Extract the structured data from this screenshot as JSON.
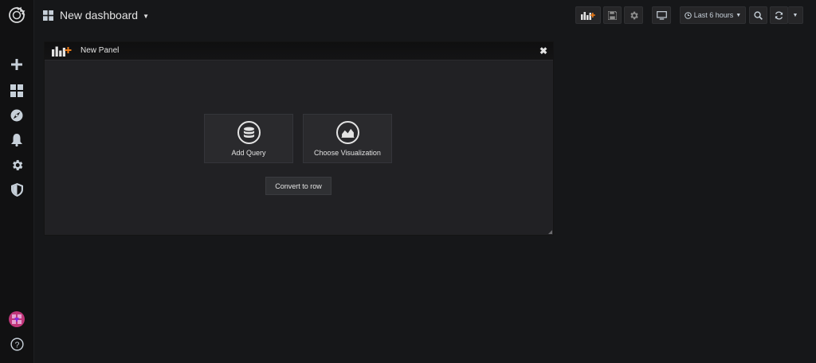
{
  "topbar": {
    "dashboard_title": "New dashboard",
    "time_range": "Last 6 hours"
  },
  "sidebar": {
    "items": [
      {
        "icon": "plus-icon"
      },
      {
        "icon": "dashboards-icon"
      },
      {
        "icon": "compass-icon"
      },
      {
        "icon": "bell-icon"
      },
      {
        "icon": "gear-icon"
      },
      {
        "icon": "shield-icon"
      }
    ],
    "bottom": [
      {
        "icon": "avatar"
      },
      {
        "icon": "help-icon"
      }
    ]
  },
  "panel": {
    "title": "New Panel",
    "actions": {
      "add_query": "Add Query",
      "choose_visualization": "Choose Visualization",
      "convert_to_row": "Convert to row"
    }
  },
  "colors": {
    "background": "#161719",
    "sidebar": "#111112",
    "panel": "#212124",
    "accent": "#eb7b18"
  }
}
